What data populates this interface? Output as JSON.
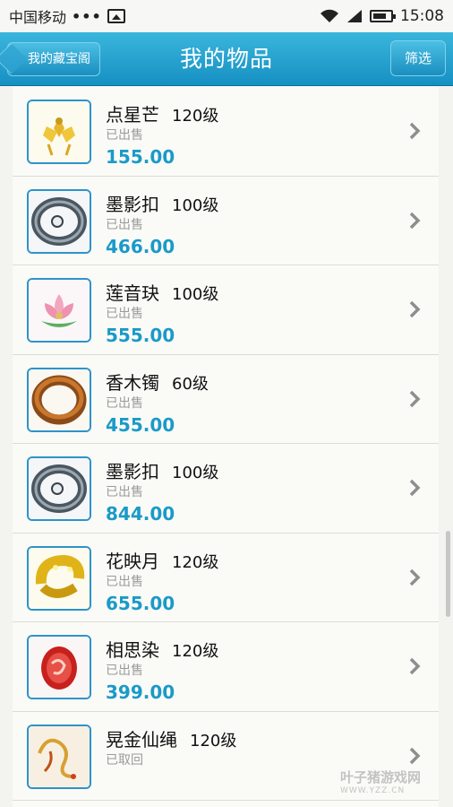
{
  "statusbar": {
    "carrier": "中国移动",
    "dots": "•••",
    "time": "15:08"
  },
  "header": {
    "back_label": "我的藏宝阁",
    "title": "我的物品",
    "filter_label": "筛选"
  },
  "items": [
    {
      "name": "点星芒",
      "level": "120级",
      "status": "已出售",
      "price": "155.00",
      "icon": "gold-lotus-ornament-icon"
    },
    {
      "name": "墨影扣",
      "level": "100级",
      "status": "已出售",
      "price": "466.00",
      "icon": "dark-ring-icon"
    },
    {
      "name": "莲音玦",
      "level": "100级",
      "status": "已出售",
      "price": "555.00",
      "icon": "pink-lotus-icon"
    },
    {
      "name": "香木镯",
      "level": "60级",
      "status": "已出售",
      "price": "455.00",
      "icon": "wood-bangle-icon"
    },
    {
      "name": "墨影扣",
      "level": "100级",
      "status": "已出售",
      "price": "844.00",
      "icon": "dark-ring-icon"
    },
    {
      "name": "花映月",
      "level": "120级",
      "status": "已出售",
      "price": "655.00",
      "icon": "gold-bracelet-icon"
    },
    {
      "name": "相思染",
      "level": "120级",
      "status": "已出售",
      "price": "399.00",
      "icon": "red-gem-icon"
    },
    {
      "name": "晃金仙绳",
      "level": "120级",
      "status": "已取回",
      "price": "",
      "icon": "gold-rope-icon"
    }
  ],
  "watermark": {
    "brand": "叶子猪",
    "suffix": "游戏网",
    "url": "WWW.YZZ.CN"
  }
}
